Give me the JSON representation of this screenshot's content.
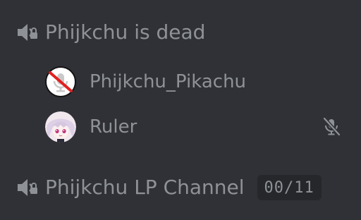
{
  "channels": [
    {
      "name": "Phijkchu is dead",
      "icon": "locked-speaker-icon",
      "members": [
        {
          "name": "Phijkchu_Pikachu",
          "avatar": "muted-mic-avatar",
          "muted": false
        },
        {
          "name": "Ruler",
          "avatar": "anime-girl-avatar",
          "muted": true
        }
      ]
    },
    {
      "name": "Phijkchu LP Channel",
      "icon": "locked-speaker-icon",
      "user_limit": "00/11"
    }
  ],
  "colors": {
    "background": "#303136",
    "text": "#8e9297",
    "badge_bg": "#26272b",
    "mute_red": "#ed4245"
  }
}
